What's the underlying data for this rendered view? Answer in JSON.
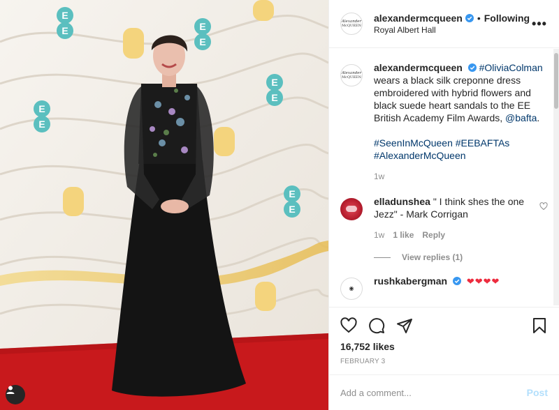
{
  "header": {
    "username": "alexandermcqueen",
    "separator": "•",
    "follow_state": "Following",
    "location": "Royal Albert Hall",
    "more": "•••"
  },
  "avatar_logo": {
    "line1": "Alexander",
    "line2": "McQUEEN"
  },
  "caption": {
    "username": "alexandermcqueen",
    "mention": "#OliviaColman",
    "text": " wears a black silk creponne dress embroidered with hybrid flowers and black suede heart sandals to the EE British Academy Film Awards, ",
    "tag_account": "@bafta",
    "hashtag1": "#SeenInMcQueen",
    "hashtag2": "#EEBAFTAs",
    "hashtag3": "#AlexanderMcQueen",
    "time": "1w"
  },
  "comments": [
    {
      "username": "elladunshea",
      "text": "\" I think shes the one Jezz\" - Mark Corrigan",
      "time": "1w",
      "likes": "1 like",
      "reply": "Reply",
      "view_replies": "View replies (1)"
    },
    {
      "username": "rushkabergman",
      "text": "❤❤❤❤"
    }
  ],
  "actions": {
    "likes": "16,752 likes",
    "date": "February 3"
  },
  "add_comment": {
    "placeholder": "Add a comment...",
    "post": "Post"
  },
  "colors": {
    "link": "#00376b",
    "verified": "#3897f0",
    "heart": "#ed2b3e",
    "post_disabled": "#b2dffc",
    "carpet": "#c8191c"
  }
}
